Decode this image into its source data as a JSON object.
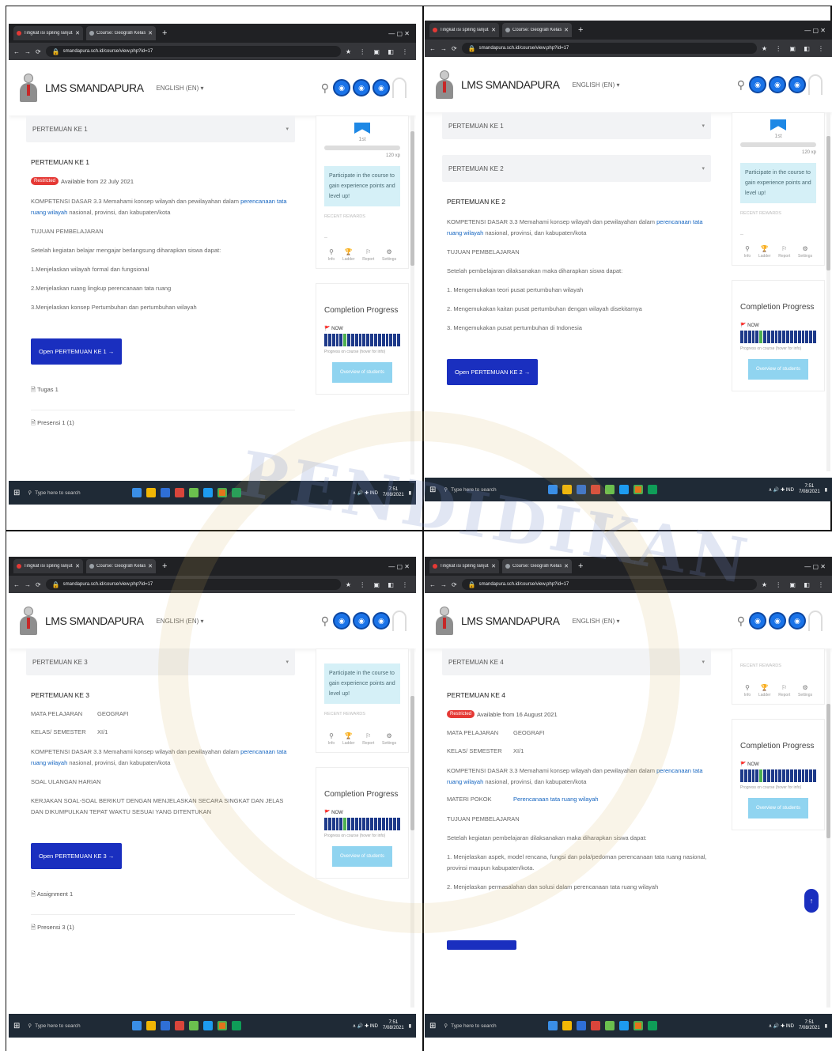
{
  "browser": {
    "tab1": "Tingkat isi spiling lanjutan",
    "tab2": "Course: Geografi Kelas XI",
    "new_tab": "+",
    "window_controls": "—   ▢   ✕",
    "url": "smandapura.sch.id/course/view.php?id=17",
    "extensions": "★ ⋮ ▣ ◧ ⋮"
  },
  "site": {
    "brand": "LMS SMANDAPURA",
    "language": "ENGLISH (EN) ▾"
  },
  "panels": [
    {
      "accordions": [
        "PERTEMUAN KE 1"
      ],
      "section_title": "PERTEMUAN KE 1",
      "badge": "Restricted",
      "available": "Available from 22 July 2021",
      "lines": [
        {
          "text": "KOMPETENSI DASAR 3.3 Memahami konsep wilayah dan pewilayahan dalam ",
          "link": "perencanaan tata ruang wilayah",
          "rest": " nasional, provinsi, dan kabupaten/kota"
        },
        {
          "text": "TUJUAN PEMBELAJARAN"
        },
        {
          "text": "Setelah kegiatan belajar mengajar berlangsung diharapkan siswa dapat:"
        },
        {
          "text": "1.Menjelaskan wilayah formal dan fungsional"
        },
        {
          "text": "2.Menjelaskan ruang lingkup perencanaan tata ruang"
        },
        {
          "text": "3.Menjelaskan konsep Pertumbuhan dan pertumbuhan wilayah"
        }
      ],
      "button": "Open PERTEMUAN KE 1  →",
      "footer": [
        "🗎 Tugas 1",
        "🗎 Presensi 1 (1)"
      ]
    },
    {
      "accordions": [
        "PERTEMUAN KE 1",
        "PERTEMUAN KE 2"
      ],
      "section_title": "PERTEMUAN KE 2",
      "lines": [
        {
          "text": "KOMPETENSI DASAR  3.3  Memahami konsep wilayah dan pewilayahan dalam ",
          "link": "perencanaan tata ruang wilayah",
          "rest": " nasional, provinsi, dan kabupaten/kota"
        },
        {
          "text": "TUJUAN PEMBELAJARAN"
        },
        {
          "text": "Setelah pembelajaran dilaksanakan maka diharapkan siswa dapat:"
        },
        {
          "text": "1.    Mengemukakan teori pusat pertumbuhan wilayah"
        },
        {
          "text": "2.    Mengemukakan kaitan pusat pertumbuhan dengan wilayah disekitarnya"
        },
        {
          "text": "3.    Mengemukakan pusat pertumbuhan di Indonesia"
        }
      ],
      "button": "Open PERTEMUAN KE 2  →"
    },
    {
      "accordions": [
        "PERTEMUAN KE 3"
      ],
      "section_title": "PERTEMUAN KE 3",
      "kv": [
        {
          "k": "MATA PELAJARAN",
          "v": "GEOGRAFI"
        },
        {
          "k": "KELAS/ SEMESTER",
          "v": "XI/1"
        }
      ],
      "lines": [
        {
          "text": "KOMPETENSI DASAR       3.3  Memahami konsep wilayah dan pewilayahan dalam ",
          "link": "perencanaan tata ruang wilayah",
          "rest": " nasional, provinsi, dan kabupaten/kota"
        },
        {
          "text": "SOAL ULANGAN HARIAN"
        },
        {
          "text": "KERJAKAN SOAL-SOAL BERIKUT DENGAN MENJELASKAN SECARA SINGKAT DAN JELAS DAN DIKUMPULKAN TEPAT WAKTU SESUAI YANG DITENTUKAN"
        }
      ],
      "button": "Open PERTEMUAN KE 3  →",
      "footer": [
        "🗎 Assignment 1",
        "🗎 Presensi 3 (1)"
      ]
    },
    {
      "accordions": [
        "PERTEMUAN KE 4"
      ],
      "section_title": "PERTEMUAN KE 4",
      "badge": "Restricted",
      "available": "Available from 16 August 2021",
      "kv": [
        {
          "k": "MATA PELAJARAN",
          "v": "GEOGRAFI"
        },
        {
          "k": "KELAS/ SEMESTER",
          "v": "XI/1"
        }
      ],
      "lines": [
        {
          "text": "KOMPETENSI DASAR        3.3  Memahami konsep wilayah dan pewilayahan dalam ",
          "link": "perencanaan tata ruang wilayah",
          "rest": " nasional, provinsi, dan kabupaten/kota"
        }
      ],
      "kv2": [
        {
          "k": "MATERI POKOK",
          "v": "Perencanaan tata ruang wilayah"
        }
      ],
      "lines2": [
        {
          "text": "TUJUAN PEMBELAJARAN"
        },
        {
          "text": "Setelah kegiatan pembelajaran dilaksanakan maka diharapkan siswa dapat:"
        },
        {
          "text": "1.   Menjelaskan aspek, model rencana, fungsi dan pola/pedoman perencanaan tata ruang nasional, provinsi maupun kabupaten/kota."
        },
        {
          "text": "2.   Menjelaskan permasalahan dan solusi dalam perencanaan tata ruang wilayah"
        }
      ]
    }
  ],
  "sidebar": {
    "level": "1st",
    "xp": "120 xp",
    "tip": "Participate in the course to gain experience points and level up!",
    "note": "RECENT REWARDS",
    "dash": "–",
    "stats": [
      {
        "icon": "⚲",
        "label": "Info"
      },
      {
        "icon": "🏆",
        "label": "Ladder"
      },
      {
        "icon": "⚐",
        "label": "Report"
      },
      {
        "icon": "⚙",
        "label": "Settings"
      }
    ],
    "completion_title": "Completion Progress",
    "percent": "🚩 NOW",
    "progress_note": "Progress on course (hover for info)",
    "completion_button": "Overview of students"
  },
  "taskbar": {
    "search": "Type here to search",
    "tray": "∧ 🔊 ✚ IND",
    "time": "7:51",
    "date": "7/08/2021"
  },
  "progress": {
    "segments": 20,
    "done_index": 5
  }
}
